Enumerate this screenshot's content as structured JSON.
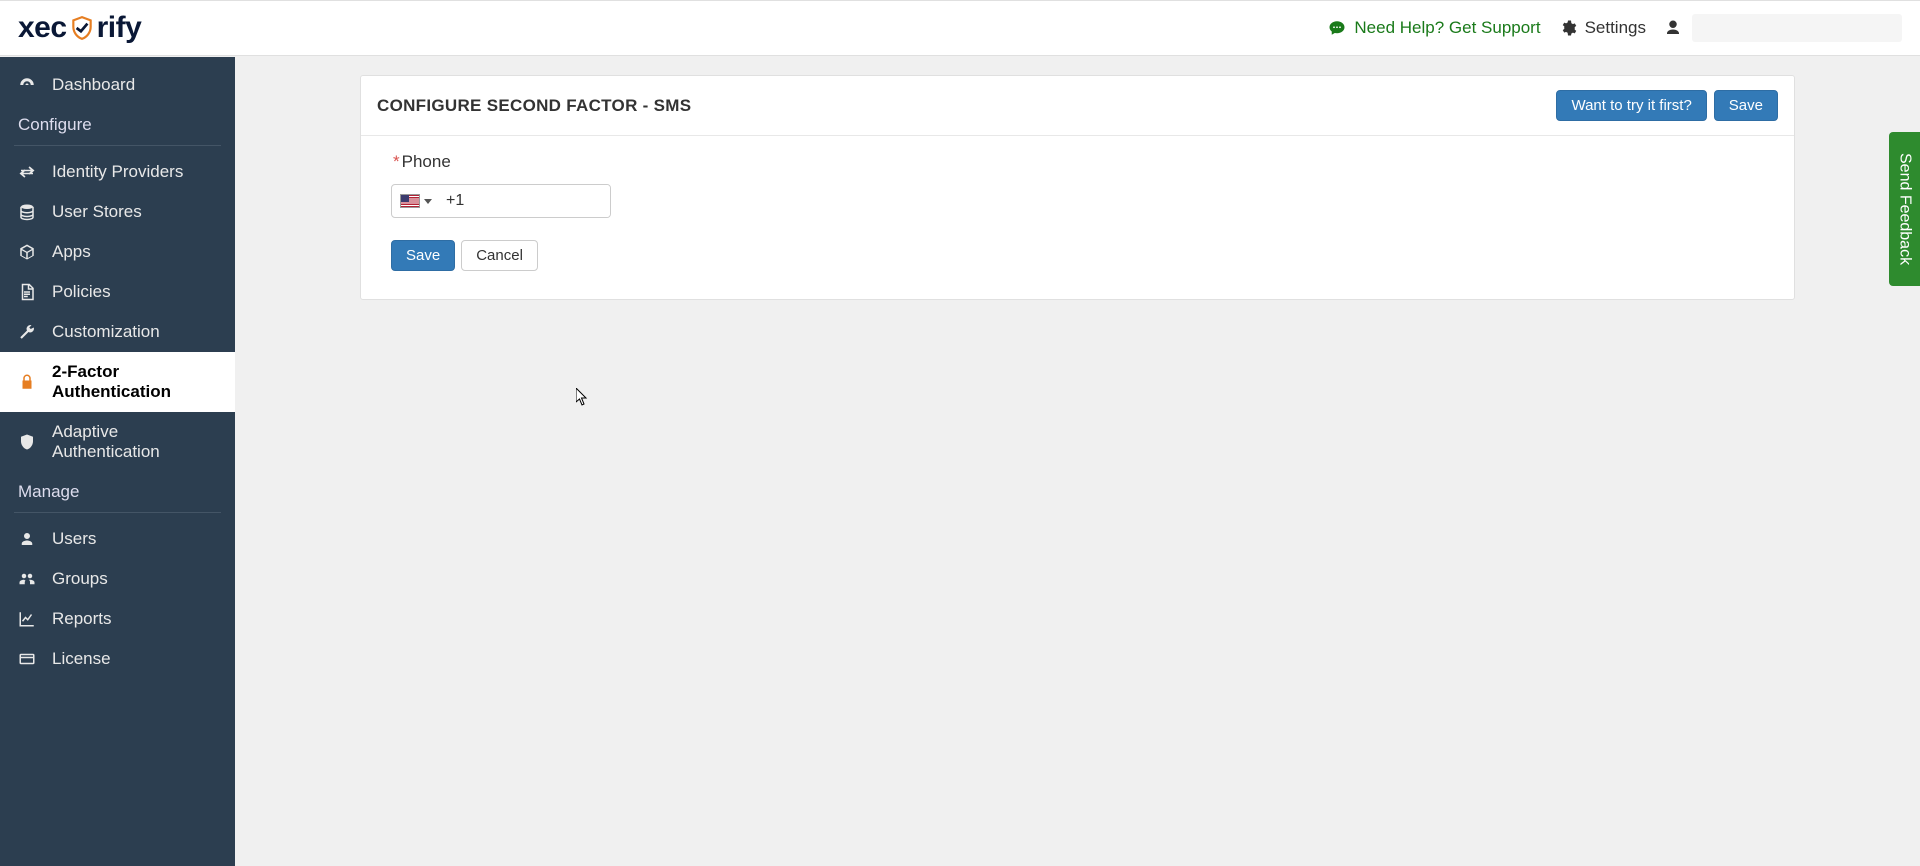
{
  "brand": {
    "part1": "xec",
    "part2": "rify"
  },
  "topbar": {
    "help_label": "Need Help? Get Support",
    "settings_label": "Settings",
    "user_name": ""
  },
  "sidebar": {
    "items_top": [
      {
        "label": "Dashboard",
        "icon": "dashboard"
      }
    ],
    "section_configure": "Configure",
    "items_configure": [
      {
        "label": "Identity Providers",
        "icon": "exchange"
      },
      {
        "label": "User Stores",
        "icon": "database"
      },
      {
        "label": "Apps",
        "icon": "cube"
      },
      {
        "label": "Policies",
        "icon": "file"
      },
      {
        "label": "Customization",
        "icon": "wrench"
      },
      {
        "label": "2-Factor Authentication",
        "icon": "lock",
        "active": true
      },
      {
        "label": "Adaptive Authentication",
        "icon": "shield"
      }
    ],
    "section_manage": "Manage",
    "items_manage": [
      {
        "label": "Users",
        "icon": "user"
      },
      {
        "label": "Groups",
        "icon": "users"
      },
      {
        "label": "Reports",
        "icon": "chart"
      },
      {
        "label": "License",
        "icon": "card"
      }
    ]
  },
  "panel": {
    "title": "CONFIGURE SECOND FACTOR - SMS",
    "try_label": "Want to try it first?",
    "save_label": "Save",
    "phone_label": "Phone",
    "dial_code": "+1",
    "form_save": "Save",
    "form_cancel": "Cancel"
  },
  "feedback_label": "Send Feedback"
}
